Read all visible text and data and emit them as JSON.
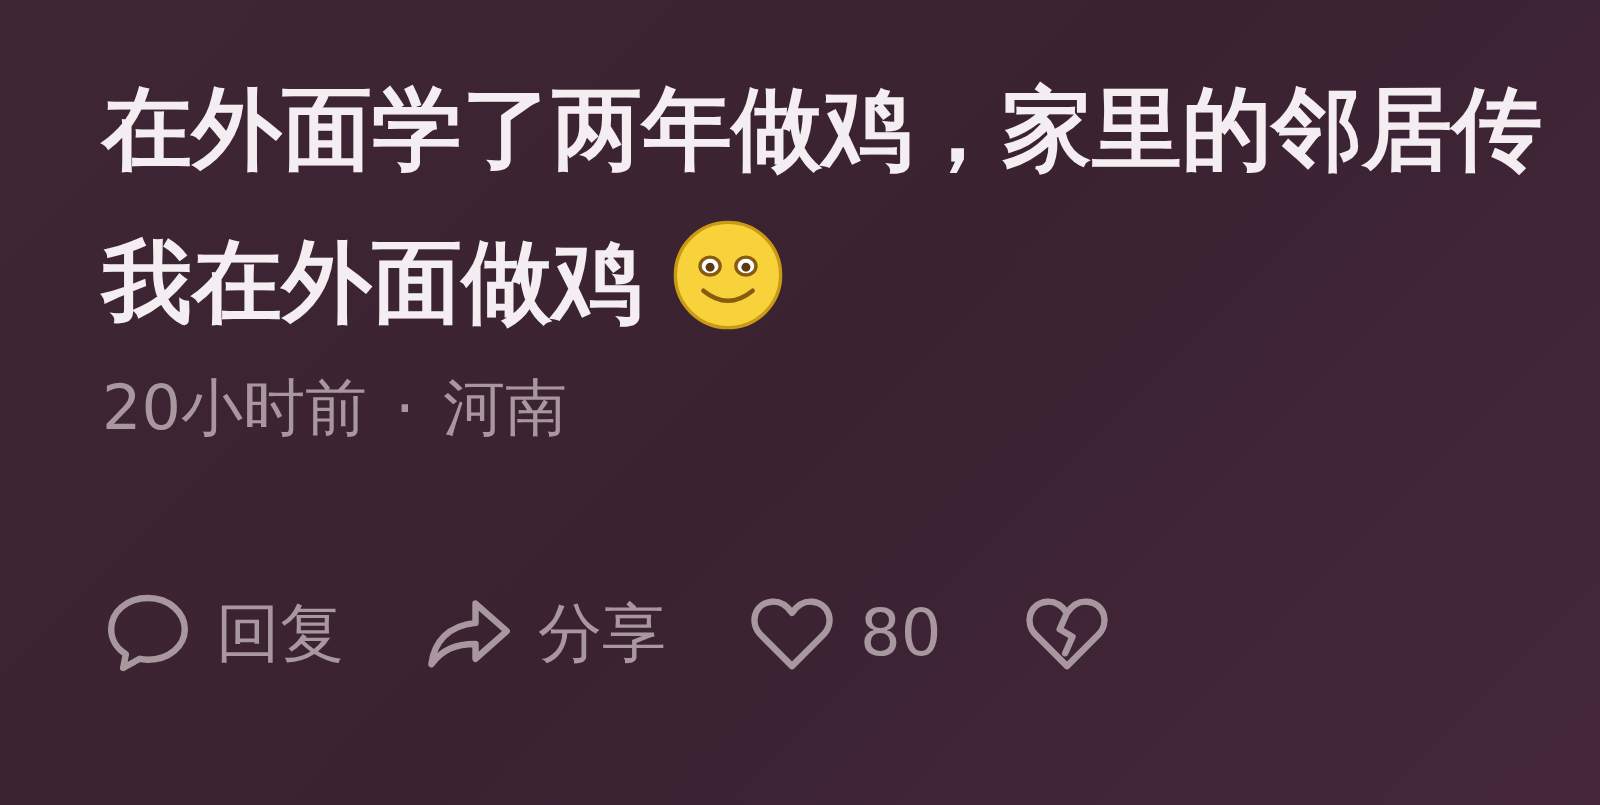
{
  "comment": {
    "text": "在外面学了两年做鸡，家里的邻居传我在外面做鸡",
    "time": "20小时前",
    "separator": "·",
    "location": "河南"
  },
  "actions": [
    {
      "kind": "reply",
      "label": "回复"
    },
    {
      "kind": "share",
      "label": "分享"
    },
    {
      "kind": "like",
      "label": "80"
    },
    {
      "kind": "dislike"
    }
  ]
}
